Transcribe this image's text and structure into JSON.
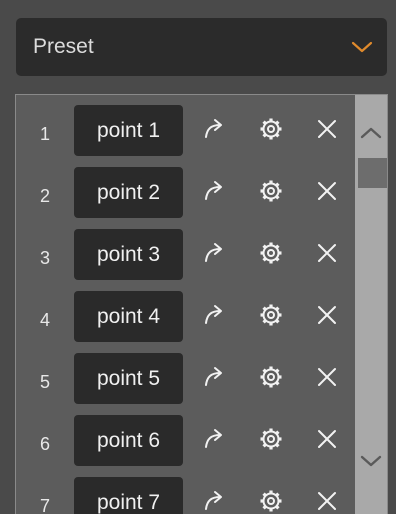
{
  "preset": {
    "label": "Preset",
    "chevron_icon": "chevron-down-icon",
    "accent_color": "#e08a2c"
  },
  "points": [
    {
      "number": "1",
      "name": "point 1"
    },
    {
      "number": "2",
      "name": "point 2"
    },
    {
      "number": "3",
      "name": "point 3"
    },
    {
      "number": "4",
      "name": "point 4"
    },
    {
      "number": "5",
      "name": "point 5"
    },
    {
      "number": "6",
      "name": "point 6"
    },
    {
      "number": "7",
      "name": "point 7"
    }
  ],
  "row_icons": [
    "goto-arrow-icon",
    "gear-icon",
    "close-icon"
  ],
  "scrollbar": {
    "up_icon": "chevron-up-icon",
    "down_icon": "chevron-down-icon"
  }
}
